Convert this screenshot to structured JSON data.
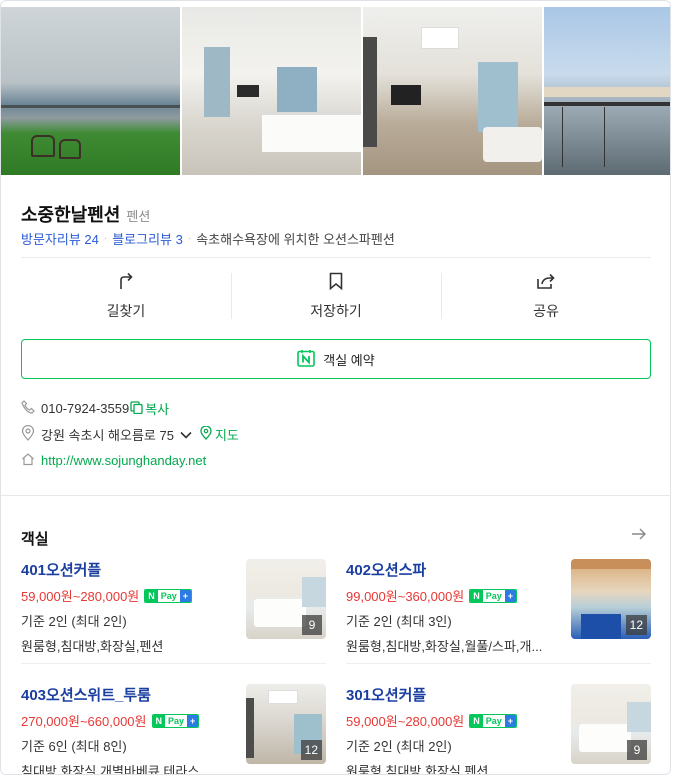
{
  "place": {
    "name": "소중한날펜션",
    "category": "펜션",
    "visitor_reviews": "방문자리뷰 24",
    "blog_reviews": "블로그리뷰 3",
    "description": "속초해수욕장에 위치한 오션스파펜션"
  },
  "actions": {
    "directions": "길찾기",
    "save": "저장하기",
    "share": "공유"
  },
  "reserve_label": "객실 예약",
  "info": {
    "phone": "010-7924-3559",
    "copy_label": "복사",
    "address": "강원 속초시 해오름로 75",
    "map_label": "지도",
    "website": "http://www.sojunghanday.net"
  },
  "rooms_section": {
    "title": "객실",
    "npay_label": "Pay",
    "rooms": [
      {
        "name": "401오션커플",
        "price": "59,000원~280,000원",
        "capacity": "기준 2인 (최대 2인)",
        "features": "원룸형,침대방,화장실,펜션",
        "photo_count": "9"
      },
      {
        "name": "402오션스파",
        "price": "99,000원~360,000원",
        "capacity": "기준 2인 (최대 3인)",
        "features": "원룸형,침대방,화장실,월풀/스파,개...",
        "photo_count": "12"
      },
      {
        "name": "403오션스위트_투룸",
        "price": "270,000원~660,000원",
        "capacity": "기준 6인 (최대 8인)",
        "features": "침대방,화장실,개별바베큐,테라스,...",
        "photo_count": "12"
      },
      {
        "name": "301오션커플",
        "price": "59,000원~280,000원",
        "capacity": "기준 2인 (최대 2인)",
        "features": "원룸형,침대방,화장실,펜션",
        "photo_count": "9"
      }
    ]
  },
  "colors": {
    "naver_green": "#03c75a",
    "link_blue": "#2a5bd7",
    "room_name_blue": "#1b3fa0",
    "price_red": "#e53935"
  },
  "icons": [
    "share-arrow-icon",
    "bookmark-icon",
    "share-box-icon",
    "calendar-n-icon",
    "phone-icon",
    "copy-icon",
    "pin-icon",
    "chevron-down-icon",
    "map-pin-icon",
    "home-icon",
    "arrow-right-icon"
  ]
}
